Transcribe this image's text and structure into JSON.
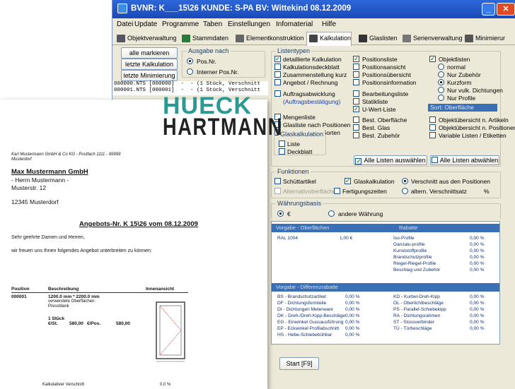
{
  "window": {
    "title": "BVNR: K___15\\26  KUNDE: S-PA  BV: Wittekind 08.12.2009"
  },
  "menu": [
    "Datei",
    "Update",
    "Programme",
    "Taben",
    "Einstellungen",
    "Infomaterial",
    "Hilfe"
  ],
  "tabs": [
    "Objektverwaltung",
    "Stammdaten",
    "Elementkonstruktion",
    "Kalkulation",
    "Glaslisten",
    "Serienverwaltung",
    "Minimierur"
  ],
  "buttons": {
    "alle_markieren": "alle markieren",
    "letzte_kalkulation": "letzte Kalkulation",
    "letzte_minimierung": "letzte Minimierung",
    "alle_auswaehlen": "Alle Listen auswählen",
    "alle_abwaehlen": "Alle Listen abwählen",
    "start": "Start  [F9]"
  },
  "ausgabe": {
    "label": "Ausgabe nach",
    "options": [
      "Pos.Nr.",
      "Interner Pos.Nr."
    ]
  },
  "lines": [
    "000000.NTS [000000]  -  - (1 Stück, Verschnitt",
    "000001.NTS [000001]  -  - (1 Stück, Verschnitt"
  ],
  "listentypen": {
    "label": "Listentypen",
    "col1": [
      "detaillierte Kalkulation",
      "Kalkulationsdeckblatt",
      "Zusammenstellung kurz",
      "Angebot / Rechnung",
      "Auftragsabwicklung",
      "(Auftragsbestätigung)",
      "Mengenliste",
      "Glasliste nach Positionen",
      "Glasliste nach Sorten"
    ],
    "col2": [
      "Positionsliste",
      "Positionsansicht",
      "Positionsübersicht",
      "Positionsinformation",
      "Bearbeitungsliste",
      "Statikliste",
      "U-Wert-Liste",
      "Best. Oberfläche",
      "Best. Glas",
      "Best. Zubehör"
    ],
    "col3": [
      "Objektlisten",
      "normal",
      "Nur Zubehör",
      "Kurzform",
      "Nur vulk. Dichtungen",
      "Nur Profile",
      "Sort: Oberfläche",
      "Objektübersicht n. Artikeln",
      "Objektübersicht n. Positionen",
      "Variable Listen / Etiketten"
    ],
    "glaskalk": {
      "label": "Glaskalkulation",
      "items": [
        "Liste",
        "Deckblatt"
      ]
    }
  },
  "funktionen": {
    "label": "Funktionen",
    "items": [
      "Schüttartikel",
      "Glaskalkulation",
      "Verschnitt aus den Positionen",
      "Alternativoberflächen",
      "Fertigungszeiten",
      "altern. Verschnittsatz",
      "%"
    ]
  },
  "waehrung": {
    "label": "Währungsbasis",
    "options": [
      "€",
      "andere Währung"
    ]
  },
  "panel": {
    "h1": "Vorgabe - Oberflächen",
    "h1r": "Rabatte",
    "ral": "RAL 1004",
    "ral_val": "1,00 €",
    "rabatte": [
      "Iso-Profile",
      "Ganzalu-profile",
      "Kunststoffprofile",
      "Brandschutzprofile",
      "Riegel-Riegel-Profile",
      "Beschlag und Zubehör"
    ],
    "pct": "0,00 %",
    "h2": "Vorgabe - Differenzrabatte",
    "diff_left": [
      "BS - Brandschutzartikel",
      "DF - Dichtungsformteile",
      "DI - Dichtungen Meterware",
      "DK - Dreh-/Dreh-Kipp-Beschläge",
      "EG - Einwinkel Gussausführung",
      "EP - Eckwinkel Profilabschnitt",
      "HS - Hebe-Schiebebühbar"
    ],
    "diff_right": [
      "KD - Kurbel-Dreh-Kipp",
      "OL - Oberlichtbeschläge",
      "PS - Parallel-Schiebekipp",
      "RA - Dichtungsrahmen",
      "ST - Stossverbinder",
      "TÜ - Türbeschläge"
    ]
  },
  "doc": {
    "logo1": "HUECK",
    "logo2": "HARTMANN",
    "sender": "Karl Mustermann GmbH & Co KG - Postfach 1111 - 99999",
    "sender2": "Musterdorf",
    "company": "Max Mustermann GmbH",
    "person": "- Herrn Mustermann -",
    "street": "Musterstr. 12",
    "city": "12345 Musterdorf",
    "heading": "Angebots-Nr. K     15\\26 vom 08.12.2009",
    "greeting": "Sehr geehrte Damen und Herren,",
    "intro": "wir freuen uns Ihnen folgendes Angebot unterbreiten zu können:",
    "col_pos": "Position",
    "col_desc": "Beschreibung",
    "col_view": "Innenansicht",
    "pos": "000001",
    "dim": "1200.0 mm  *  2200.0 mm",
    "surf": "verwendete Oberflächen:",
    "surf2": "Pressblank",
    "qty": "1 Stück",
    "price_lbl": "€/St.",
    "price1": "580,00",
    "price_unit": "€/Pos.",
    "price2": "580,00",
    "footer": "Kalkulativer Verschnitt",
    "footer_val": "0,0 %"
  }
}
